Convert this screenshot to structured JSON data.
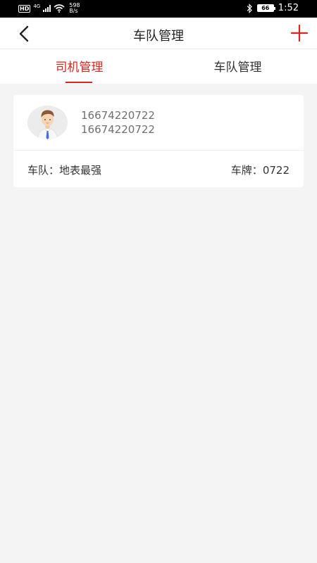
{
  "status_bar": {
    "hd": "HD",
    "network": "4G",
    "speed_value": "598",
    "speed_unit": "B/s",
    "battery": "66",
    "time": "1:52"
  },
  "nav": {
    "title": "车队管理"
  },
  "tabs": [
    {
      "label": "司机管理",
      "active": true
    },
    {
      "label": "车队管理",
      "active": false
    }
  ],
  "driver_card": {
    "name": "16674220722",
    "phone": "16674220722",
    "team_label": "车队：",
    "team_value": "地表最强",
    "plate_label": "车牌：",
    "plate_value": "0722"
  },
  "colors": {
    "accent": "#d9261f",
    "background": "#f4f4f4"
  }
}
